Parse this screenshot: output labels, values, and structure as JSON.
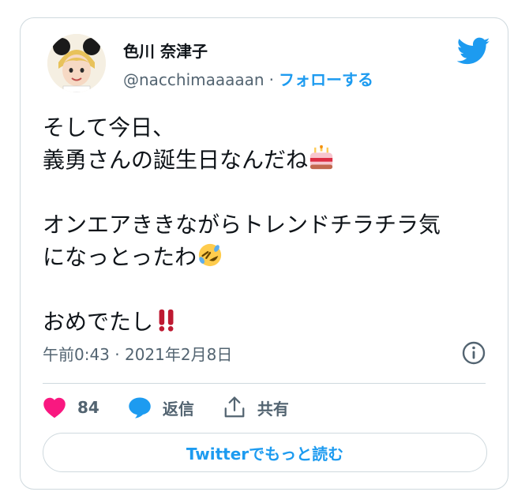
{
  "author": {
    "display_name": "色川 奈津子",
    "handle": "@nacchimaaaaan",
    "separator": "·",
    "follow_label": "フォローする"
  },
  "tweet": {
    "line1": "そして今日、",
    "line2": "義勇さんの誕生日なんだね",
    "line3": "オンエアききながらトレンドチラチラ気",
    "line4": "になっとったわ",
    "line5": "おめでたし",
    "emojis": [
      "birthday-cake-icon",
      "rolling-on-floor-laughing-icon",
      "double-exclamation-icon"
    ]
  },
  "meta": {
    "timestamp": "午前0:43 · 2021年2月8日"
  },
  "actions": {
    "like_count": "84",
    "reply_label": "返信",
    "share_label": "共有"
  },
  "read_more_label": "Twitterでもっと読む",
  "colors": {
    "accent": "#1d9bf0",
    "like": "#f91880",
    "secondary_text": "#536471",
    "border": "#cfd9de"
  }
}
